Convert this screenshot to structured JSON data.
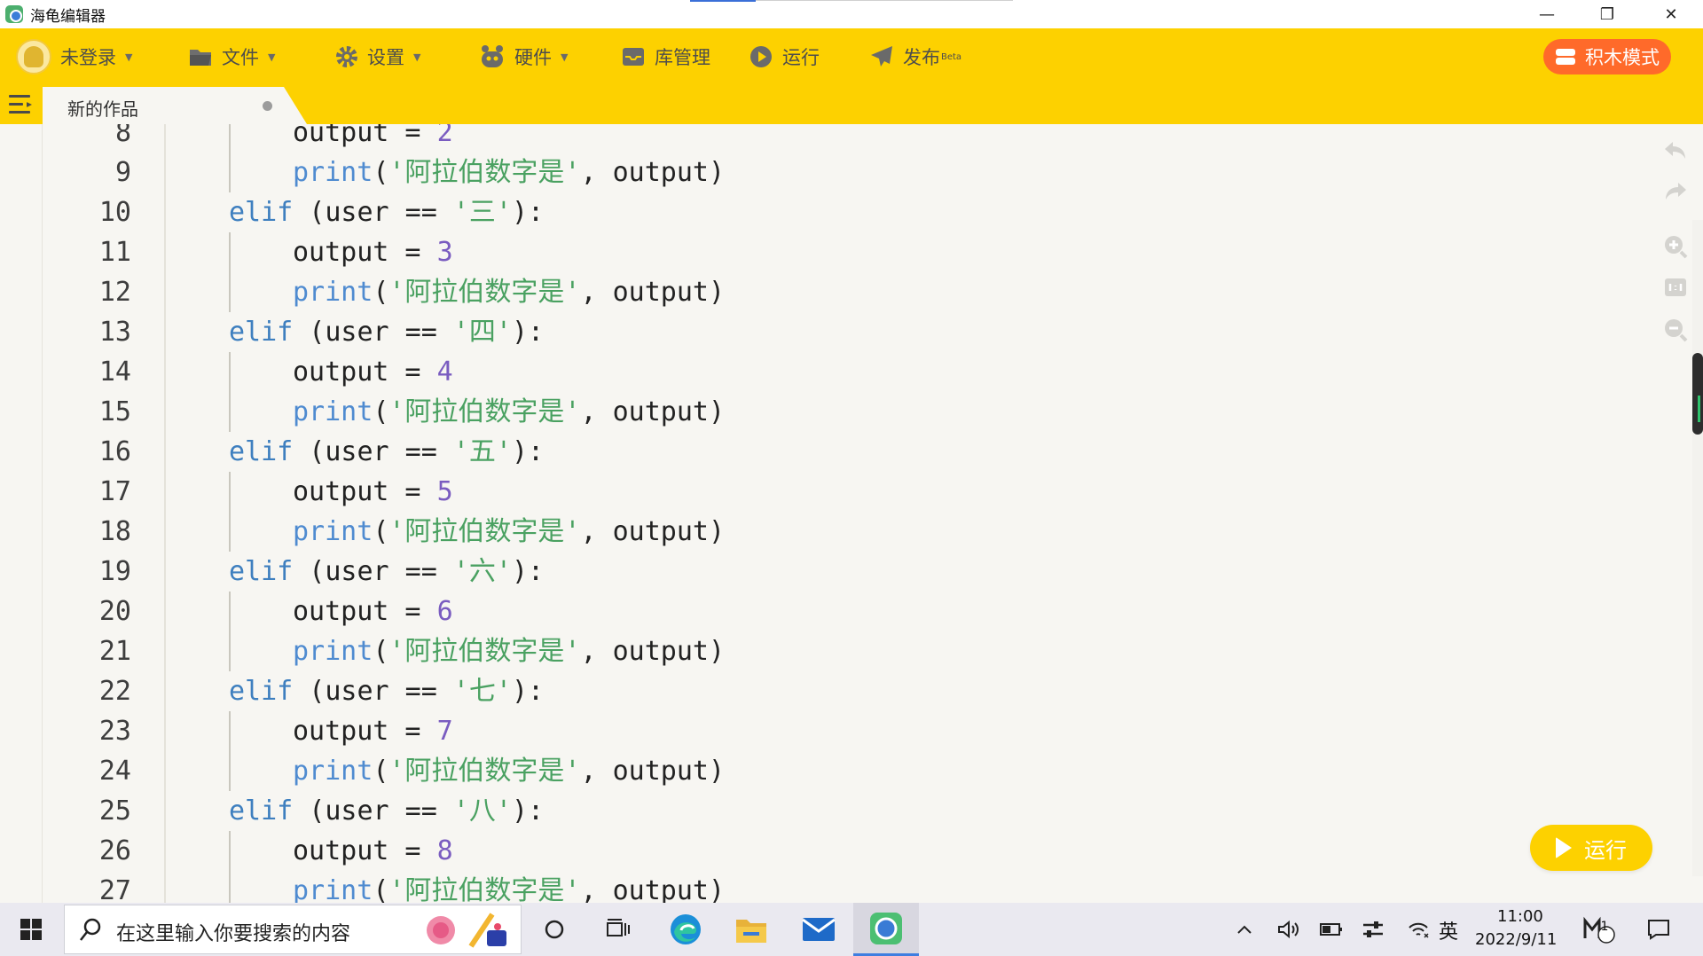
{
  "window": {
    "title": "海龟编辑器",
    "controls": {
      "minimize": "—",
      "restore": "❐",
      "close": "✕"
    }
  },
  "toolbar": {
    "login": "未登录",
    "file": "文件",
    "settings": "设置",
    "hardware": "硬件",
    "library": "库管理",
    "run": "运行",
    "publish": "发布",
    "publish_badge": "Beta",
    "blocks_mode": "积木模式"
  },
  "tab": {
    "name": "新的作品"
  },
  "editor": {
    "lines": [
      {
        "n": "8",
        "tokens": [
          [
            "indent2",
            ""
          ],
          [
            "plain",
            "output = "
          ],
          [
            "num",
            "2"
          ]
        ]
      },
      {
        "n": "9",
        "tokens": [
          [
            "indent2",
            ""
          ],
          [
            "fn",
            "print"
          ],
          [
            "plain",
            "("
          ],
          [
            "str",
            "'阿拉伯数字是'"
          ],
          [
            "plain",
            ", output)"
          ]
        ]
      },
      {
        "n": "10",
        "tokens": [
          [
            "indent1",
            ""
          ],
          [
            "kw",
            "elif"
          ],
          [
            "plain",
            " (user == "
          ],
          [
            "str",
            "'三'"
          ],
          [
            "plain",
            "):"
          ]
        ]
      },
      {
        "n": "11",
        "tokens": [
          [
            "indent2",
            ""
          ],
          [
            "plain",
            "output = "
          ],
          [
            "num",
            "3"
          ]
        ]
      },
      {
        "n": "12",
        "tokens": [
          [
            "indent2",
            ""
          ],
          [
            "fn",
            "print"
          ],
          [
            "plain",
            "("
          ],
          [
            "str",
            "'阿拉伯数字是'"
          ],
          [
            "plain",
            ", output)"
          ]
        ]
      },
      {
        "n": "13",
        "tokens": [
          [
            "indent1",
            ""
          ],
          [
            "kw",
            "elif"
          ],
          [
            "plain",
            " (user == "
          ],
          [
            "str",
            "'四'"
          ],
          [
            "plain",
            "):"
          ]
        ]
      },
      {
        "n": "14",
        "tokens": [
          [
            "indent2",
            ""
          ],
          [
            "plain",
            "output = "
          ],
          [
            "num",
            "4"
          ]
        ]
      },
      {
        "n": "15",
        "tokens": [
          [
            "indent2",
            ""
          ],
          [
            "fn",
            "print"
          ],
          [
            "plain",
            "("
          ],
          [
            "str",
            "'阿拉伯数字是'"
          ],
          [
            "plain",
            ", output)"
          ]
        ]
      },
      {
        "n": "16",
        "tokens": [
          [
            "indent1",
            ""
          ],
          [
            "kw",
            "elif"
          ],
          [
            "plain",
            " (user == "
          ],
          [
            "str",
            "'五'"
          ],
          [
            "plain",
            "):"
          ]
        ]
      },
      {
        "n": "17",
        "tokens": [
          [
            "indent2",
            ""
          ],
          [
            "plain",
            "output = "
          ],
          [
            "num",
            "5"
          ]
        ]
      },
      {
        "n": "18",
        "tokens": [
          [
            "indent2",
            ""
          ],
          [
            "fn",
            "print"
          ],
          [
            "plain",
            "("
          ],
          [
            "str",
            "'阿拉伯数字是'"
          ],
          [
            "plain",
            ", output)"
          ]
        ]
      },
      {
        "n": "19",
        "tokens": [
          [
            "indent1",
            ""
          ],
          [
            "kw",
            "elif"
          ],
          [
            "plain",
            " (user == "
          ],
          [
            "str",
            "'六'"
          ],
          [
            "plain",
            "):"
          ]
        ]
      },
      {
        "n": "20",
        "tokens": [
          [
            "indent2",
            ""
          ],
          [
            "plain",
            "output = "
          ],
          [
            "num",
            "6"
          ]
        ]
      },
      {
        "n": "21",
        "tokens": [
          [
            "indent2",
            ""
          ],
          [
            "fn",
            "print"
          ],
          [
            "plain",
            "("
          ],
          [
            "str",
            "'阿拉伯数字是'"
          ],
          [
            "plain",
            ", output)"
          ]
        ]
      },
      {
        "n": "22",
        "tokens": [
          [
            "indent1",
            ""
          ],
          [
            "kw",
            "elif"
          ],
          [
            "plain",
            " (user == "
          ],
          [
            "str",
            "'七'"
          ],
          [
            "plain",
            "):"
          ]
        ]
      },
      {
        "n": "23",
        "tokens": [
          [
            "indent2",
            ""
          ],
          [
            "plain",
            "output = "
          ],
          [
            "num",
            "7"
          ]
        ]
      },
      {
        "n": "24",
        "tokens": [
          [
            "indent2",
            ""
          ],
          [
            "fn",
            "print"
          ],
          [
            "plain",
            "("
          ],
          [
            "str",
            "'阿拉伯数字是'"
          ],
          [
            "plain",
            ", output)"
          ]
        ]
      },
      {
        "n": "25",
        "tokens": [
          [
            "indent1",
            ""
          ],
          [
            "kw",
            "elif"
          ],
          [
            "plain",
            " (user == "
          ],
          [
            "str",
            "'八'"
          ],
          [
            "plain",
            "):"
          ]
        ]
      },
      {
        "n": "26",
        "tokens": [
          [
            "indent2",
            ""
          ],
          [
            "plain",
            "output = "
          ],
          [
            "num",
            "8"
          ]
        ]
      },
      {
        "n": "27",
        "tokens": [
          [
            "indent2",
            ""
          ],
          [
            "fn",
            "print"
          ],
          [
            "plain",
            "("
          ],
          [
            "str",
            "'阿拉伯数字是'"
          ],
          [
            "plain",
            ", output)"
          ]
        ]
      }
    ],
    "run_button": "运行"
  },
  "taskbar": {
    "search_placeholder": "在这里输入你要搜索的内容",
    "ime": "英",
    "time": "11:00",
    "date": "2022/9/11",
    "notification_count": "1"
  },
  "colors": {
    "toolbar_bg": "#fdd100",
    "blocks_btn": "#ff6a2a",
    "keyword": "#3e7fbf",
    "string": "#4aa161",
    "number": "#7a5cc0"
  }
}
